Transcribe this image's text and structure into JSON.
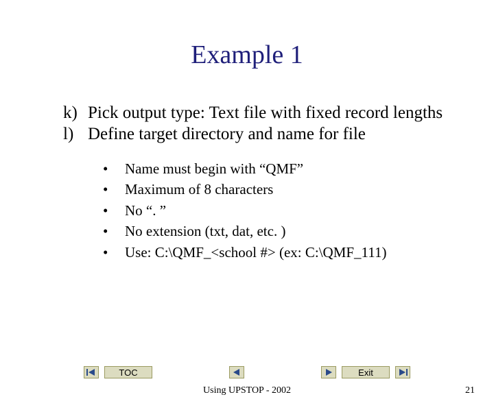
{
  "title": "Example 1",
  "items": [
    {
      "marker": "k)",
      "text": "Pick output type: Text file with fixed record lengths"
    },
    {
      "marker": "l)",
      "text": "Define target directory and name for file"
    }
  ],
  "subitems": [
    "Name must begin with “QMF”",
    "Maximum of 8 characters",
    "No “. ”",
    "No extension (txt, dat, etc. )",
    "Use:  C:\\QMF_<school #> (ex: C:\\QMF_111)"
  ],
  "nav": {
    "toc": "TOC",
    "exit": "Exit"
  },
  "footer": "Using UPSTOP - 2002",
  "page": "21"
}
